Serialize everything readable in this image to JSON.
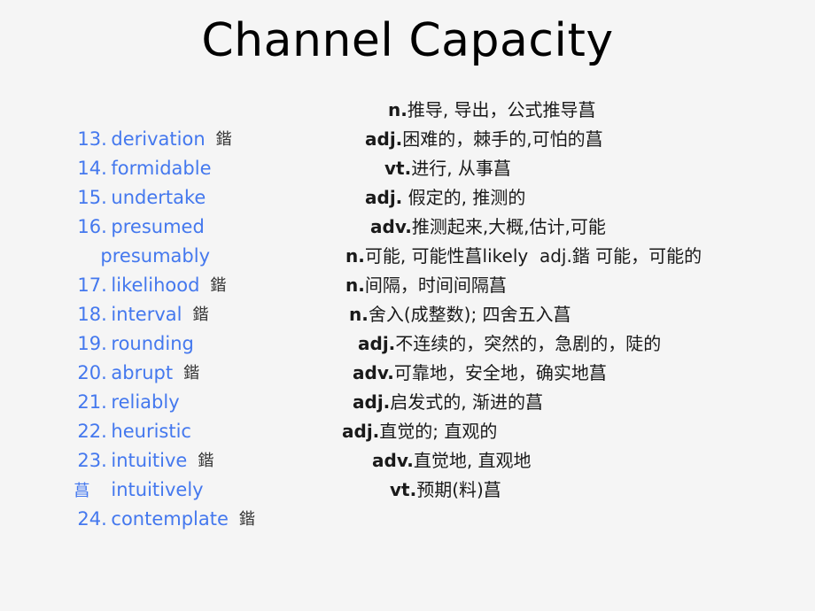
{
  "slide": {
    "title": "Channel Capacity",
    "background_color": "#f5f5f5",
    "title_color": "#000000",
    "term_color": "#4478ee",
    "definition_color": "#1a1a1a"
  },
  "rows": [
    {
      "num": "13.",
      "word": "derivation",
      "mark": "鍇",
      "mark_color": "#333333",
      "definition": "n.推导, 导出，公式推导菖",
      "pos": "n."
    },
    {
      "num": "14.",
      "word": "formidable",
      "mark": "",
      "mark_color": "#333333",
      "definition": "adj.困难的，棘手的,可怕的菖",
      "pos": "adj."
    },
    {
      "num": "15.",
      "word": "undertake",
      "mark": "",
      "mark_color": "#333333",
      "definition": "vt.进行, 从事菖",
      "pos": "vt."
    },
    {
      "num": "16.",
      "word": "presumed",
      "mark": "",
      "mark_color": "#333333",
      "definition": "adj. 假定的, 推测的",
      "pos": "adj."
    },
    {
      "num": "",
      "word": "presumably",
      "mark": "",
      "mark_color": "#333333",
      "definition": "adv.推测起来,大概,估计,可能",
      "pos": "adv."
    },
    {
      "num": "17.",
      "word": "likelihood",
      "mark": "鍇",
      "mark_color": "#333333",
      "definition": "n.可能, 可能性菖likely  adj.鍇 可能，可能的",
      "pos": "n."
    },
    {
      "num": "18.",
      "word": "interval",
      "mark": "鍇",
      "mark_color": "#333333",
      "definition": "n.间隔，时间间隔菖",
      "pos": "n."
    },
    {
      "num": "19.",
      "word": "rounding",
      "mark": "",
      "mark_color": "#333333",
      "definition": "n.舍入(成整数); 四舍五入菖",
      "pos": "n."
    },
    {
      "num": "20.",
      "word": "abrupt",
      "mark": "鍇",
      "mark_color": "#333333",
      "definition": "adj.不连续的，突然的，急剧的，陡的",
      "pos": "adj."
    },
    {
      "num": "21.",
      "word": "reliably",
      "mark": "",
      "mark_color": "#333333",
      "definition": "adv.可靠地，安全地，确实地菖",
      "pos": "adv."
    },
    {
      "num": "22.",
      "word": "heuristic",
      "mark": "",
      "mark_color": "#333333",
      "definition": "adj.启发式的, 渐进的菖",
      "pos": "adj."
    },
    {
      "num": "23.",
      "word": "intuitive",
      "mark": "鍇",
      "mark_color": "#333333",
      "definition": "adj.直觉的; 直观的",
      "pos": "adj."
    },
    {
      "num": "菖",
      "word": "intuitively",
      "mark": "",
      "mark_color": "#4478ee",
      "definition": "adv.直觉地, 直观地",
      "pos": "adv."
    },
    {
      "num": "24.",
      "word": "contemplate",
      "mark": "鍇",
      "mark_color": "#333333",
      "definition": "vt.预期(料)菖",
      "pos": "vt."
    }
  ]
}
